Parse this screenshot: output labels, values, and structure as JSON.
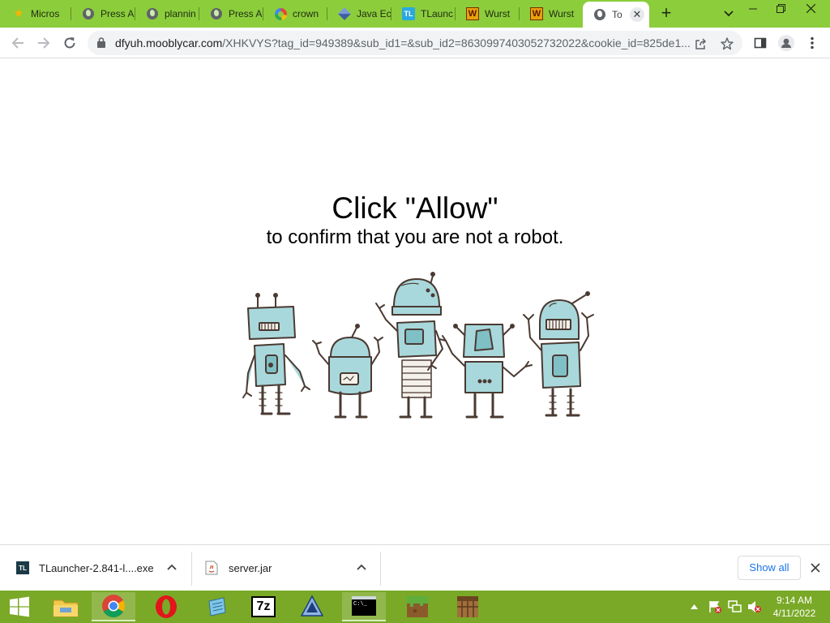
{
  "browser": {
    "tabs": [
      {
        "title": "Micros",
        "icon": "star-icon"
      },
      {
        "title": "Press A",
        "icon": "globe-icon"
      },
      {
        "title": "plannin",
        "icon": "globe-icon"
      },
      {
        "title": "Press A",
        "icon": "globe-icon"
      },
      {
        "title": "crown",
        "icon": "google-icon"
      },
      {
        "title": "Java Ec",
        "icon": "cube-icon"
      },
      {
        "title": "TLaunc",
        "icon": "tlauncher-icon"
      },
      {
        "title": "Wurst",
        "icon": "wurst-icon"
      },
      {
        "title": "Wurst",
        "icon": "wurst-icon"
      },
      {
        "title": "To",
        "icon": "globe-icon",
        "active": true
      }
    ],
    "new_tab_label": "+",
    "tl_badge": "TL",
    "wurst_badge": "W",
    "url_host": "dfyuh.mooblycar.com",
    "url_path": "/XHKVYS?tag_id=949389&sub_id1=&sub_id2=8630997403052732022&cookie_id=825de1..."
  },
  "page": {
    "headline": "Click \"Allow\"",
    "subline": "to confirm that you are not a robot."
  },
  "downloads": {
    "items": [
      {
        "name": "TLauncher-2.841-l....exe",
        "icon": "tlauncher-file-icon"
      },
      {
        "name": "server.jar",
        "icon": "java-file-icon"
      }
    ],
    "show_all_label": "Show all"
  },
  "taskbar": {
    "apps": [
      "file-explorer",
      "chrome",
      "opera",
      "notepad",
      "7zip",
      "app",
      "command-prompt",
      "minecraft",
      "crafting-table"
    ],
    "time": "9:14 AM",
    "date": "4/11/2022",
    "seven_zip_label": "7z",
    "cmd_label": "C:\\_"
  },
  "colors": {
    "tabstrip": "#8ccd3c",
    "taskbar": "#7aa927",
    "robot_fill": "#a9d8dc",
    "robot_stroke": "#4a3a32"
  }
}
